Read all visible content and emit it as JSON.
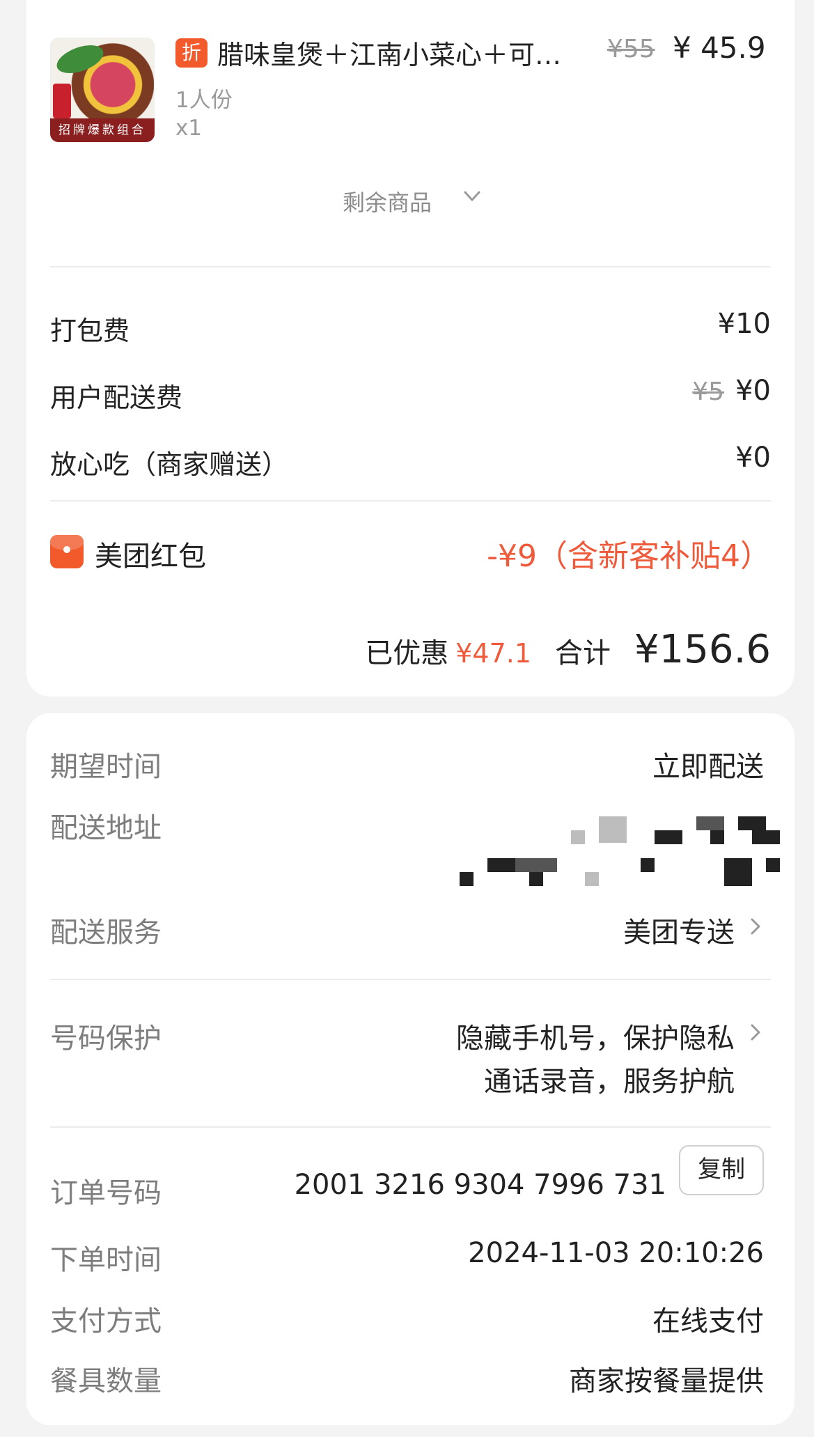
{
  "product": {
    "discount_badge": "折",
    "name": "腊味皇煲＋江南小菜心＋可…",
    "original_price": "¥55",
    "price": "¥ 45.9",
    "spec": "1人份",
    "quantity": "x1",
    "image_banner": "招牌爆款组合",
    "more_items_label": "剩余商品"
  },
  "fees": [
    {
      "label": "打包费",
      "value": "¥10"
    },
    {
      "label": "用户配送费",
      "original": "¥5",
      "value": "¥0"
    },
    {
      "label": "放心吃（商家赠送）",
      "value": "¥0"
    }
  ],
  "red_packet": {
    "label": "美团红包",
    "value": "-¥9（含新客补贴4）"
  },
  "summary": {
    "discount_label": "已优惠",
    "discount_value": "¥47.1",
    "total_label": "合计",
    "total_value": "¥156.6"
  },
  "details": {
    "expected_time": {
      "label": "期望时间",
      "value": "立即配送"
    },
    "address": {
      "label": "配送地址"
    },
    "service": {
      "label": "配送服务",
      "value": "美团专送"
    },
    "number_protection": {
      "label": "号码保护",
      "line1": "隐藏手机号，保护隐私",
      "line2": "通话录音，服务护航"
    },
    "order_no": {
      "label": "订单号码",
      "value": "2001 3216 9304 7996 731",
      "copy_label": "复制"
    },
    "order_time": {
      "label": "下单时间",
      "value": "2024-11-03 20:10:26"
    },
    "payment": {
      "label": "支付方式",
      "value": "在线支付"
    },
    "utensils": {
      "label": "餐具数量",
      "value": "商家按餐量提供"
    }
  },
  "colors": {
    "accent": "#ee5a3a",
    "badge": "#f25a2c",
    "muted": "#9a9a9a"
  }
}
